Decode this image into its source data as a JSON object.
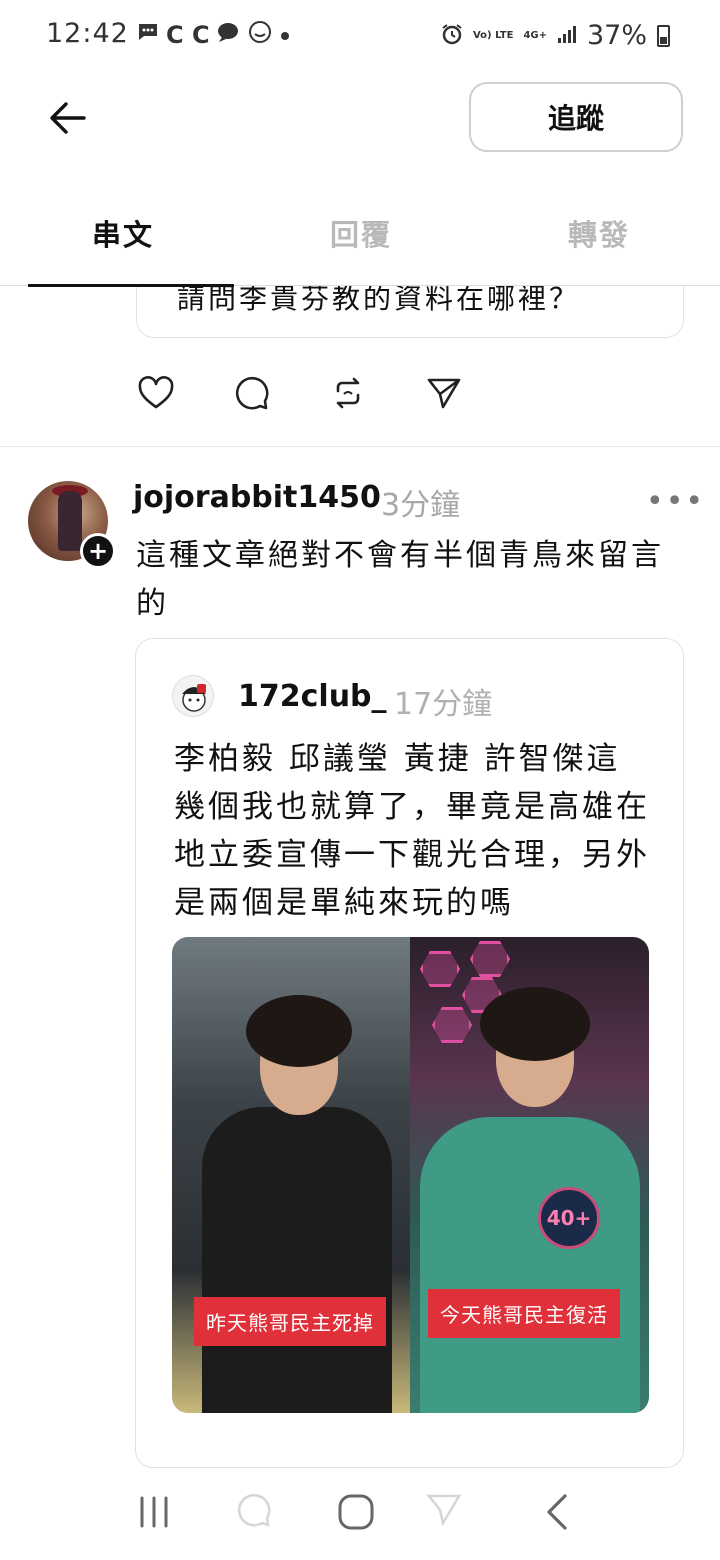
{
  "status_bar": {
    "time": "12:42",
    "notifications": "C C",
    "network": "Vo) LTE",
    "network2": "4G+",
    "battery": "37%"
  },
  "header": {
    "follow_label": "追蹤",
    "tabs": [
      {
        "label": "串文",
        "active": true
      },
      {
        "label": "回覆",
        "active": false
      },
      {
        "label": "轉發",
        "active": false
      }
    ]
  },
  "previous_post": {
    "quoted_text_fragment": "請問李貴芬教的資料在哪裡？"
  },
  "post": {
    "username": "jojorabbit1450",
    "time": "3分鐘",
    "more": "•••",
    "text": "這種文章絕對不會有半個青鳥來留言的",
    "quoted": {
      "username": "172club_",
      "time": "17分鐘",
      "text": "李柏毅 邱議瑩 黃捷 許智傑這幾個我也就算了，畢竟是高雄在地立委宣傳一下觀光合理，另外是兩個是單純來玩的嗎",
      "image_captions": [
        "昨天熊哥民主死掉",
        "今天熊哥民主復活"
      ],
      "sign_text": "40+"
    }
  },
  "colors": {
    "caption_bg": "#e0303a",
    "muted_text": "#a8a8a8",
    "tab_inactive": "#b9b9b9"
  }
}
